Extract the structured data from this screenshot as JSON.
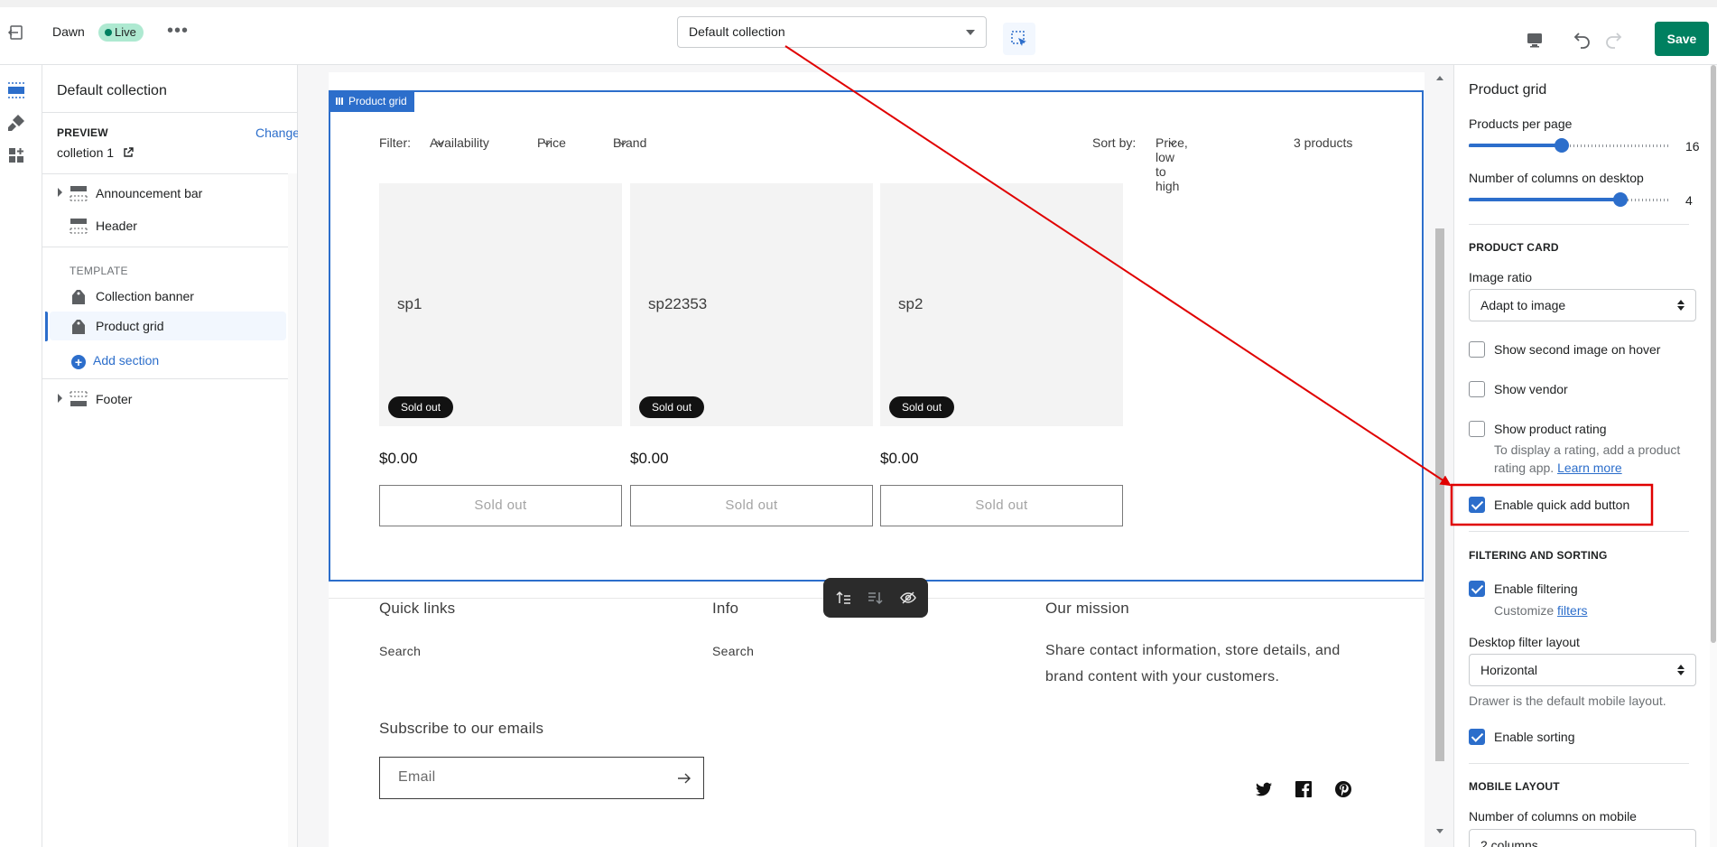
{
  "topbar": {
    "theme_name": "Dawn",
    "live_badge": "Live",
    "template_select": "Default collection",
    "save_label": "Save"
  },
  "sidebar": {
    "title": "Default collection",
    "preview_label": "PREVIEW",
    "change_link": "Change",
    "preview_value": "colletion 1",
    "header_items": [
      {
        "label": "Announcement bar"
      },
      {
        "label": "Header"
      }
    ],
    "template_label": "TEMPLATE",
    "template_items": [
      {
        "label": "Collection banner"
      },
      {
        "label": "Product grid"
      }
    ],
    "add_section": "Add section",
    "footer_items": [
      {
        "label": "Footer"
      }
    ]
  },
  "preview": {
    "frame_tag": "Product grid",
    "filter_label": "Filter:",
    "filters": [
      "Availability",
      "Price",
      "Brand"
    ],
    "sort_label": "Sort by:",
    "sort_value": "Price, low to high",
    "product_count": "3 products",
    "products": [
      {
        "name": "sp1",
        "badge": "Sold out",
        "price": "$0.00",
        "button": "Sold out"
      },
      {
        "name": "sp22353",
        "badge": "Sold out",
        "price": "$0.00",
        "button": "Sold out"
      },
      {
        "name": "sp2",
        "badge": "Sold out",
        "price": "$0.00",
        "button": "Sold out"
      }
    ],
    "footer": {
      "quick_links_title": "Quick links",
      "quick_links_item": "Search",
      "info_title": "Info",
      "info_item": "Search",
      "mission_title": "Our mission",
      "mission_text": "Share contact information, store details, and brand content with your customers.",
      "subscribe_title": "Subscribe to our emails",
      "email_placeholder": "Email"
    }
  },
  "settings": {
    "title": "Product grid",
    "products_per_page_label": "Products per page",
    "products_per_page": "16",
    "products_per_page_fraction": 0.46,
    "columns_desktop_label": "Number of columns on desktop",
    "columns_desktop": "4",
    "columns_desktop_fraction": 0.75,
    "product_card_head": "PRODUCT CARD",
    "image_ratio_label": "Image ratio",
    "image_ratio_value": "Adapt to image",
    "show_second_image": "Show second image on hover",
    "show_vendor": "Show vendor",
    "show_rating": "Show product rating",
    "rating_help": "To display a rating, add a product rating app.",
    "learn_more": "Learn more",
    "quick_add": "Enable quick add button",
    "filtering_head": "FILTERING AND SORTING",
    "enable_filtering": "Enable filtering",
    "customize_prefix": "Customize",
    "filters_link": "filters",
    "desktop_filter_layout_label": "Desktop filter layout",
    "desktop_filter_layout_value": "Horizontal",
    "drawer_help": "Drawer is the default mobile layout.",
    "enable_sorting": "Enable sorting",
    "mobile_head": "MOBILE LAYOUT",
    "columns_mobile_label": "Number of columns on mobile",
    "columns_mobile_value": "2 columns"
  },
  "colors": {
    "accent": "#2c6ecb",
    "save": "#008060",
    "annotation": "#e00000"
  }
}
